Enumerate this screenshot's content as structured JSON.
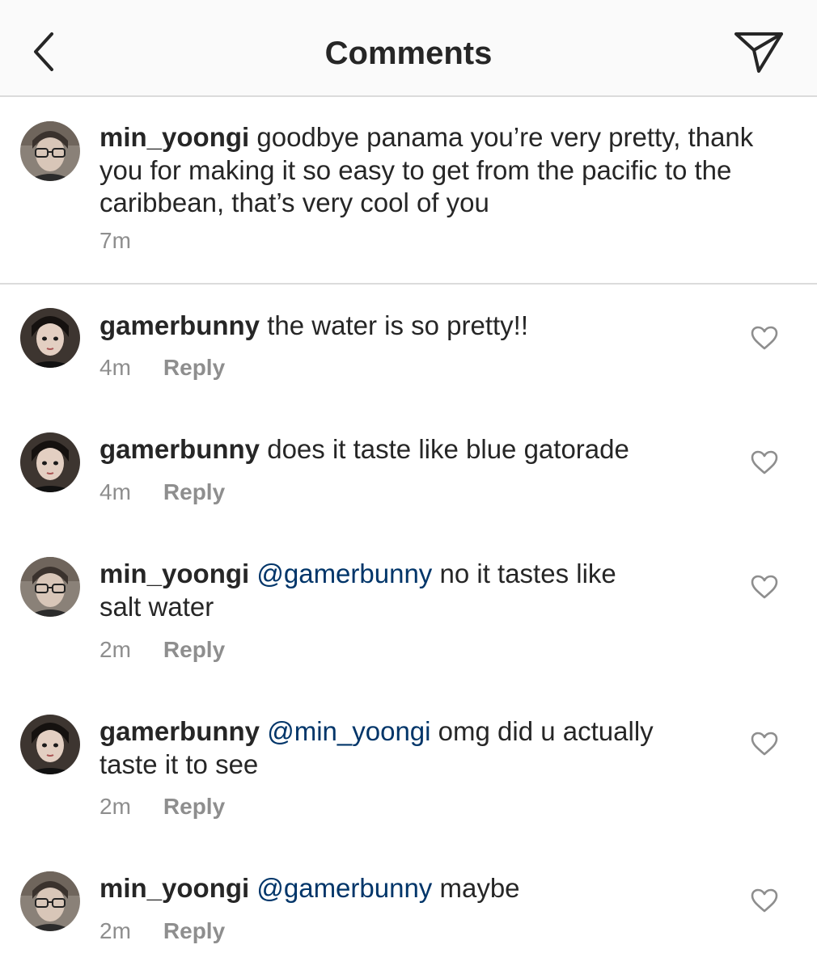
{
  "header": {
    "title": "Comments",
    "back_icon": "chevron-left-icon",
    "share_icon": "direct-share-icon"
  },
  "caption": {
    "username": "min_yoongi",
    "text": "goodbye panama you’re very pretty, thank you for making it so easy to get from the pacific to the caribbean, that’s very cool of you",
    "time": "7m"
  },
  "comments": [
    {
      "username": "gamerbunny",
      "mention": "",
      "text": "the water is so pretty!!",
      "time": "4m",
      "reply_label": "Reply"
    },
    {
      "username": "gamerbunny",
      "mention": "",
      "text": "does it taste like blue gatorade",
      "time": "4m",
      "reply_label": "Reply"
    },
    {
      "username": "min_yoongi",
      "mention": "@gamerbunny",
      "text": "no it tastes like salt water",
      "time": "2m",
      "reply_label": "Reply"
    },
    {
      "username": "gamerbunny",
      "mention": "@min_yoongi",
      "text": "omg did u actually taste it to see",
      "time": "2m",
      "reply_label": "Reply"
    },
    {
      "username": "min_yoongi",
      "mention": "@gamerbunny",
      "text": "maybe",
      "time": "2m",
      "reply_label": "Reply"
    }
  ],
  "colors": {
    "text": "#262626",
    "secondary": "#8e8e8e",
    "mention": "#003569",
    "divider": "#dbdbdb",
    "header_bg": "#fafafa"
  }
}
